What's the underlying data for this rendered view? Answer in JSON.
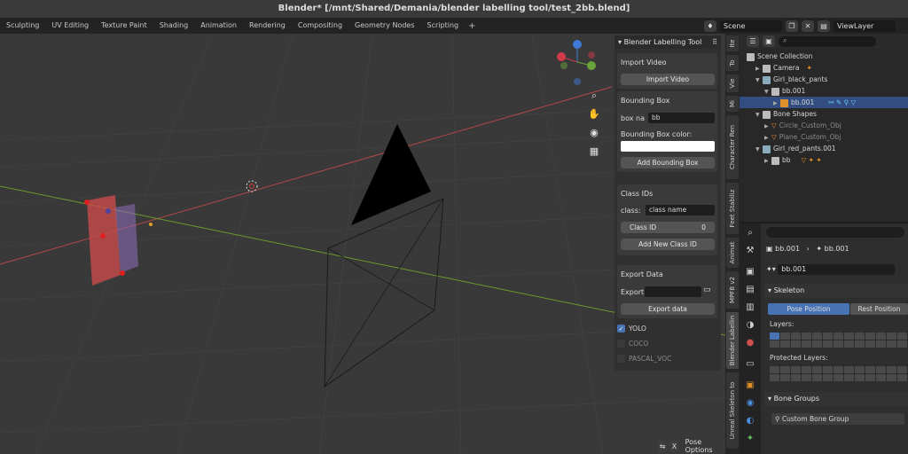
{
  "window": {
    "title": "Blender* [/mnt/Shared/Demania/blender labelling tool/test_2bb.blend]"
  },
  "workspaces": [
    "Sculpting",
    "UV Editing",
    "Texture Paint",
    "Shading",
    "Animation",
    "Rendering",
    "Compositing",
    "Geometry Nodes",
    "Scripting"
  ],
  "scene_bar": {
    "scene": "Scene",
    "view_layer": "ViewLayer"
  },
  "viewport": {
    "mode_menu": "Pose Options",
    "x_toggle": "X"
  },
  "labelling_panel": {
    "title": "Blender Labelling Tool",
    "import": {
      "header": "Import Video",
      "button": "Import Video"
    },
    "bbox": {
      "header": "Bounding Box",
      "name_label": "box na",
      "name_value": "bb",
      "color_label": "Bounding Box color:",
      "add_button": "Add Bounding Box"
    },
    "class": {
      "header": "Class IDs",
      "class_label": "class:",
      "class_placeholder": "class name",
      "id_label": "Class ID",
      "id_value": "0",
      "add_button": "Add New Class ID"
    },
    "export": {
      "header": "Export Data",
      "export_label": "Export:",
      "export_button": "Export data"
    },
    "formats": [
      {
        "label": "YOLO",
        "checked": true
      },
      {
        "label": "COCO",
        "checked": false
      },
      {
        "label": "PASCAL_VOC",
        "checked": false
      }
    ]
  },
  "side_tabs": [
    "Ite",
    "To",
    "Vie",
    "Mi",
    "Character Ren",
    "Feet Stabiliz",
    "Animat",
    "MPFB v2",
    "Blender Labellin",
    "Unreal Skeleton to"
  ],
  "outliner": {
    "rows": [
      "Scene Collection",
      "Camera",
      "Girl_black_pants",
      "bb.001",
      "bb.001",
      "Bone Shapes",
      "Circle_Custom_Obj",
      "Plane_Custom_Obj",
      "Girl_red_pants.001",
      "bb"
    ]
  },
  "properties": {
    "breadcrumb": [
      "bb.001",
      "bb.001"
    ],
    "data_name": "bb.001",
    "skeleton_header": "Skeleton",
    "pose_position": "Pose Position",
    "rest_position": "Rest Position",
    "layers_label": "Layers:",
    "protected_label": "Protected Layers:",
    "bone_groups_header": "Bone Groups",
    "custom_group": "Custom Bone Group"
  }
}
